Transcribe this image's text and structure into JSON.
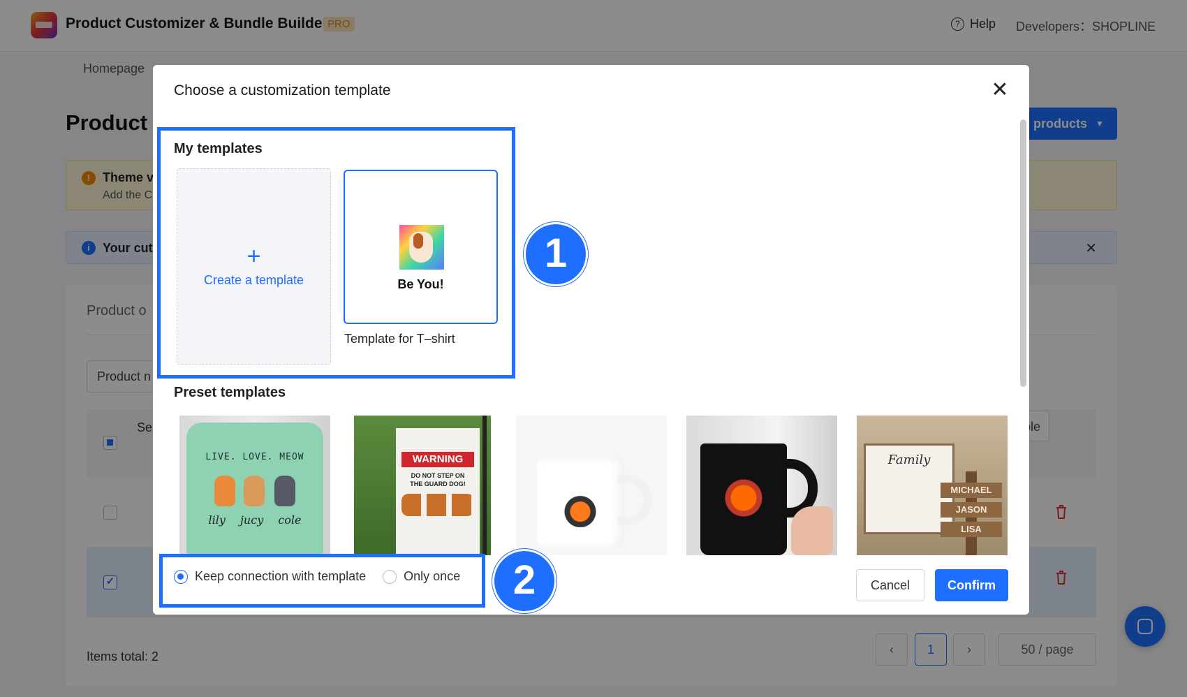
{
  "app": {
    "title": "Product Customizer & Bundle Builder",
    "badge": "PRO",
    "help_label": "Help",
    "developer_label": "Developers：SHOPLINE"
  },
  "background": {
    "breadcrumb": "Homepage",
    "page_heading": "Product",
    "primary_button": "products",
    "warning_title": "Theme v",
    "warning_body": "Add the C",
    "info_text": "Your cut",
    "section_title": "Product o",
    "search_placeholder": "Product n",
    "column_select": "Se",
    "column_button": "ble",
    "items_total": "Items total: 2",
    "pagination": {
      "prev": "‹",
      "current": "1",
      "next": "›",
      "page_size": "50 / page"
    }
  },
  "modal": {
    "title": "Choose a customization template",
    "close_icon": "close-icon",
    "my_templates": {
      "label": "My templates",
      "create_plus": "+",
      "create_label": "Create a template",
      "templates": [
        {
          "image_caption": "Be You!",
          "name": "Template for T–shirt"
        }
      ]
    },
    "preset_templates": {
      "label": "Preset templates",
      "items": [
        {
          "kind": "pillow",
          "headline": "LIVE. LOVE. MEOW",
          "names": "lily jucy cole"
        },
        {
          "kind": "garden-flag",
          "headline": "WARNING",
          "sub": "DO NOT STEP ON\nTHE GUARD DOG!"
        },
        {
          "kind": "white-mug"
        },
        {
          "kind": "black-mug"
        },
        {
          "kind": "wood-sign",
          "headline": "Family",
          "planks": [
            "MICHAEL",
            "JASON",
            "LISA"
          ]
        }
      ]
    },
    "link_options": [
      {
        "label": "Keep connection with template",
        "selected": true
      },
      {
        "label": "Only once",
        "selected": false
      }
    ],
    "cancel_label": "Cancel",
    "confirm_label": "Confirm"
  },
  "callouts": [
    "1",
    "2"
  ],
  "colors": {
    "accent": "#1e6fff",
    "danger": "#e0342f",
    "overlay": "rgba(0,0,0,0.45)"
  }
}
